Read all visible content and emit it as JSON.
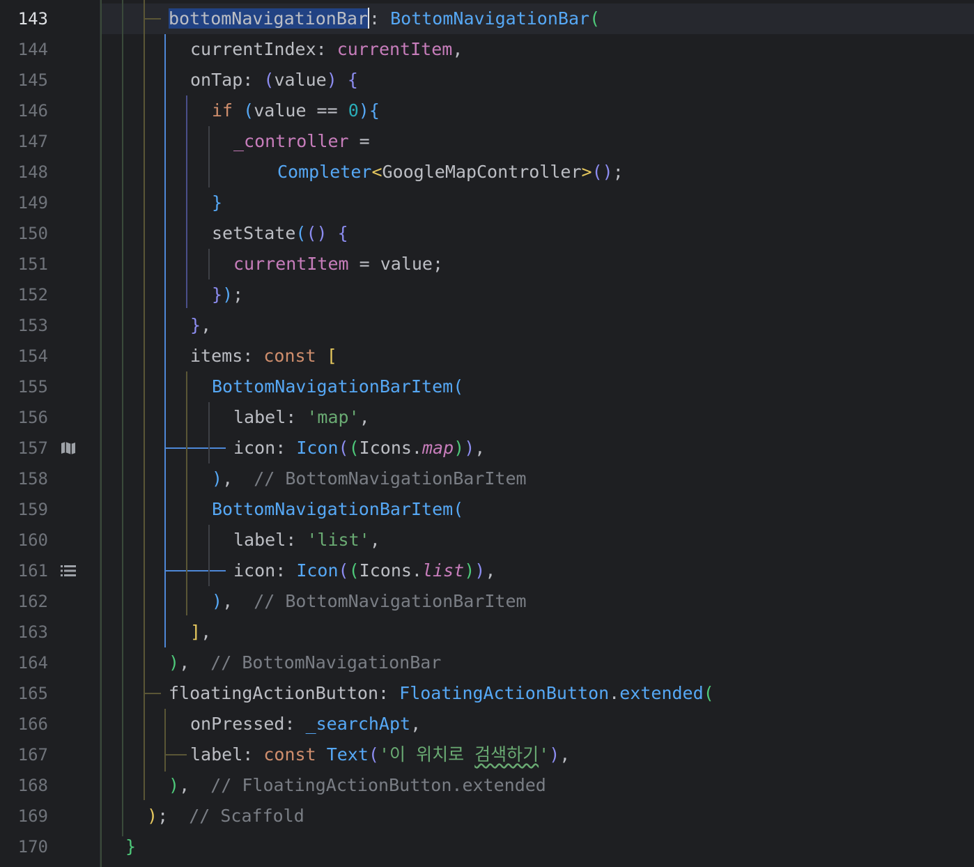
{
  "editor": {
    "current_line": 143,
    "gutter_icons": [
      "map-icon",
      "list-icon"
    ]
  },
  "lines": [
    {
      "n": "143"
    },
    {
      "n": "144"
    },
    {
      "n": "145"
    },
    {
      "n": "146"
    },
    {
      "n": "147"
    },
    {
      "n": "148"
    },
    {
      "n": "149"
    },
    {
      "n": "150"
    },
    {
      "n": "151"
    },
    {
      "n": "152"
    },
    {
      "n": "153"
    },
    {
      "n": "154"
    },
    {
      "n": "155"
    },
    {
      "n": "156"
    },
    {
      "n": "157"
    },
    {
      "n": "158"
    },
    {
      "n": "159"
    },
    {
      "n": "160"
    },
    {
      "n": "161"
    },
    {
      "n": "162"
    },
    {
      "n": "163"
    },
    {
      "n": "164"
    },
    {
      "n": "165"
    },
    {
      "n": "166"
    },
    {
      "n": "167"
    },
    {
      "n": "168"
    },
    {
      "n": "169"
    },
    {
      "n": "170"
    }
  ],
  "code": {
    "l143": {
      "prop": "bottomNavigationBar",
      "colon": ": ",
      "cls": "BottomNavigationBar",
      "open": "("
    },
    "l144": {
      "prop": "currentIndex",
      "colon": ": ",
      "val": "currentItem",
      "end": ","
    },
    "l145": {
      "prop": "onTap",
      "colon": ": ",
      "popen": "(",
      "param": "value",
      "pclose": ")",
      "sp": " ",
      "brace": "{"
    },
    "l146": {
      "kw": "if",
      "sp": " ",
      "popen": "(",
      "id": "value ==",
      "sp2": " ",
      "num": "0",
      "pclose": ")",
      "brace": "{"
    },
    "l147": {
      "id": "_controller",
      "rest": " ="
    },
    "l148": {
      "cls": "Completer",
      "lt": "<",
      "type": "GoogleMapController",
      "gt": ">",
      "call": "()",
      "end": ";"
    },
    "l149": {
      "brace": "}"
    },
    "l150": {
      "id": "setState",
      "popen": "(",
      "call": "()",
      "sp": " ",
      "brace": "{"
    },
    "l151": {
      "prop": "currentItem",
      "rest": " = value;"
    },
    "l152": {
      "brace": "}",
      "pclose": ")",
      "end": ";"
    },
    "l153": {
      "brace": "}",
      "end": ","
    },
    "l154": {
      "prop": "items",
      "colon": ": ",
      "kw": "const",
      "sp": " ",
      "open": "["
    },
    "l155": {
      "cls": "BottomNavigationBarItem",
      "open": "("
    },
    "l156": {
      "prop": "label",
      "colon": ": ",
      "str": "'map'",
      "end": ","
    },
    "l157": {
      "prop": "icon",
      "colon": ": ",
      "cls": "Icon",
      "popen": "(",
      "pin": "(",
      "id": "Icons.",
      "field": "map",
      "pin_close": ")",
      "pclose": ")",
      "end": ","
    },
    "l158": {
      "close": ")",
      "end": ",  ",
      "cmt": "// BottomNavigationBarItem"
    },
    "l159": {
      "cls": "BottomNavigationBarItem",
      "open": "("
    },
    "l160": {
      "prop": "label",
      "colon": ": ",
      "str": "'list'",
      "end": ","
    },
    "l161": {
      "prop": "icon",
      "colon": ": ",
      "cls": "Icon",
      "popen": "(",
      "pin": "(",
      "id": "Icons.",
      "field": "list",
      "pin_close": ")",
      "pclose": ")",
      "end": ","
    },
    "l162": {
      "close": ")",
      "end": ",  ",
      "cmt": "// BottomNavigationBarItem"
    },
    "l163": {
      "close": "]",
      "end": ","
    },
    "l164": {
      "close": ")",
      "end": ",  ",
      "cmt": "// BottomNavigationBar"
    },
    "l165": {
      "prop": "floatingActionButton",
      "colon": ": ",
      "cls": "FloatingActionButton",
      "dot": ".",
      "method": "extended",
      "open": "("
    },
    "l166": {
      "prop": "onPressed",
      "colon": ": ",
      "fn": "_searchApt",
      "end": ","
    },
    "l167": {
      "prop": "label",
      "colon": ": ",
      "kw": "const",
      "sp": " ",
      "cls": "Text",
      "popen": "(",
      "str1": "'이 위치로 ",
      "str2": "검색하기",
      "str3": "'",
      "pclose": ")",
      "end": ","
    },
    "l168": {
      "close": ")",
      "end": ",  ",
      "cmt": "// FloatingActionButton.extended"
    },
    "l169": {
      "close": ")",
      "end": ";  ",
      "cmt": "// Scaffold"
    },
    "l170": {
      "close": "}"
    }
  }
}
